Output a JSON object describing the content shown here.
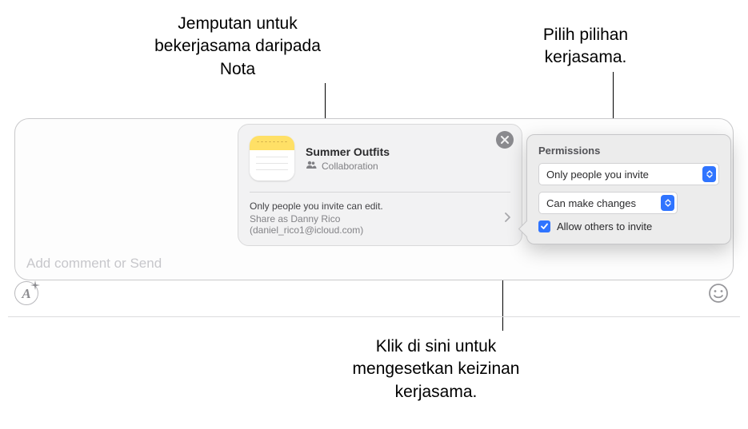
{
  "annotations": {
    "invite": "Jemputan untuk bekerjasama daripada Nota",
    "options": "Pilih pilihan kerjasama.",
    "permissions_hint": "Klik di sini untuk mengesetkan keizinan kerjasama."
  },
  "card": {
    "title": "Summer Outfits",
    "subtitle": "Collaboration",
    "line1": "Only people you invite can edit.",
    "line2": "Share as Danny Rico",
    "line3": "(daniel_rico1@icloud.com)"
  },
  "compose": {
    "placeholder": "Add comment or Send"
  },
  "popover": {
    "title": "Permissions",
    "who": "Only people you invite",
    "can": "Can make changes",
    "allow_label": "Allow others to invite",
    "allow_checked": true
  }
}
